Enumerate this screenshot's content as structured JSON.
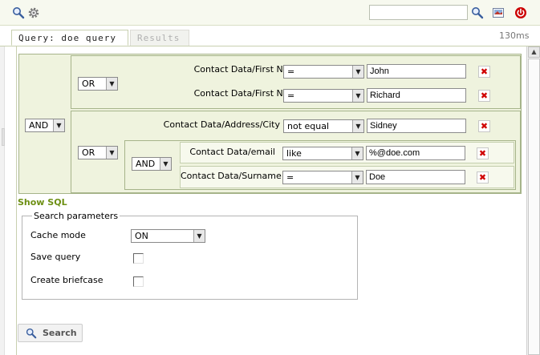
{
  "toolbar": {
    "icons": [
      "search-icon",
      "gear-icon",
      "zoom-icon",
      "image-icon",
      "power-icon"
    ],
    "search_value": "",
    "colors": {
      "power": "#cc0000",
      "accent": "#6d8f13"
    }
  },
  "tabs": [
    {
      "label": "Query: doe query",
      "active": true
    },
    {
      "label": "Results",
      "active": false
    }
  ],
  "timing": "130ms",
  "query": {
    "root_operator": "AND",
    "group1": {
      "operator": "OR",
      "rows": [
        {
          "field": "Contact Data/First Name",
          "op": "=",
          "value": "John"
        },
        {
          "field": "Contact Data/First Name",
          "op": "=",
          "value": "Richard"
        }
      ]
    },
    "group2": {
      "operator": "OR",
      "row": {
        "field": "Contact Data/Address/City",
        "op": "not equal",
        "value": "Sidney"
      },
      "subgroup": {
        "operator": "AND",
        "rows": [
          {
            "field": "Contact Data/email",
            "op": "like",
            "value": "%@doe.com"
          },
          {
            "field": "Contact Data/Surname",
            "op": "=",
            "value": "Doe"
          }
        ]
      }
    },
    "delete_glyph": "✖"
  },
  "show_sql": "Show SQL",
  "params": {
    "legend": "Search parameters",
    "cache_mode_label": "Cache mode",
    "cache_mode_value": "ON",
    "save_query_label": "Save query",
    "save_query_checked": false,
    "briefcase_label": "Create briefcase",
    "briefcase_checked": false
  },
  "search_button": "Search"
}
